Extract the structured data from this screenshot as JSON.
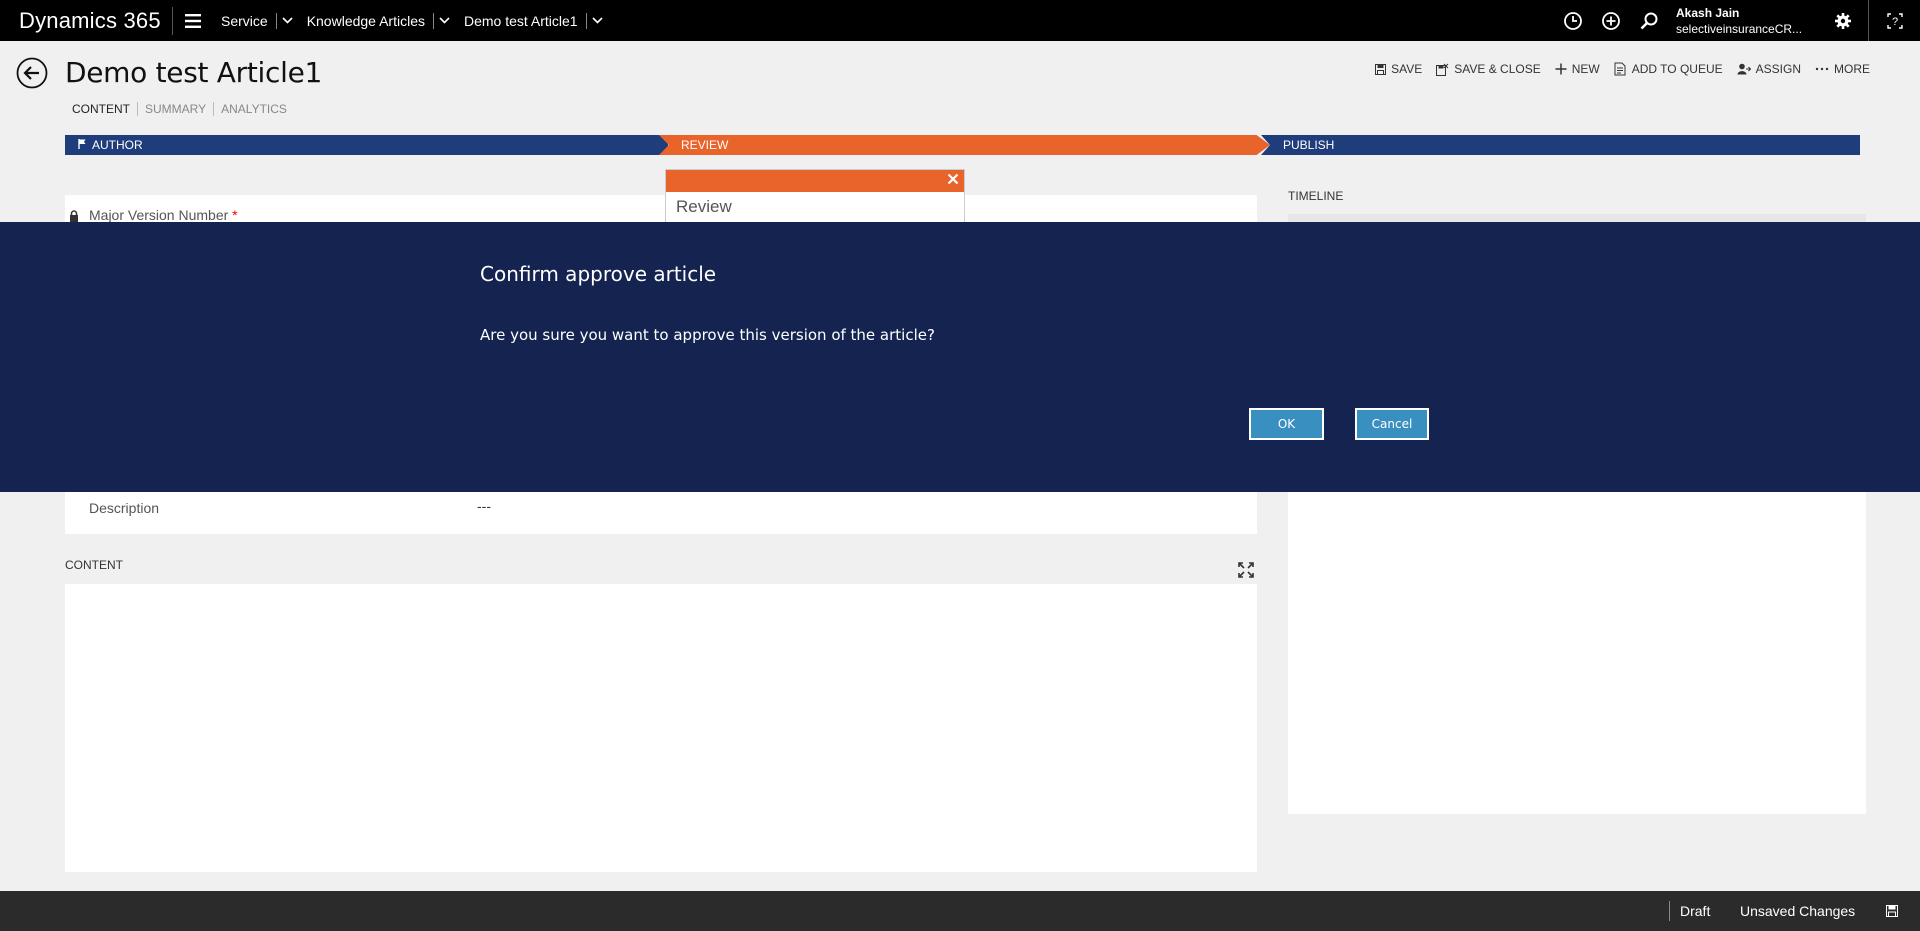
{
  "topnav": {
    "brand": "Dynamics 365",
    "breadcrumbs": [
      "Service",
      "Knowledge Articles",
      "Demo test Article1"
    ],
    "user_name": "Akash Jain",
    "user_org": "selectiveinsuranceCR...",
    "help_label": "?"
  },
  "header": {
    "title": "Demo test Article1",
    "tabs": [
      "CONTENT",
      "SUMMARY",
      "ANALYTICS"
    ],
    "commands": [
      "SAVE",
      "SAVE & CLOSE",
      "NEW",
      "ADD TO QUEUE",
      "ASSIGN",
      "MORE"
    ]
  },
  "process": {
    "stages": [
      "AUTHOR",
      "REVIEW",
      "PUBLISH"
    ],
    "active_stage": "REVIEW",
    "active_color": "#e8642a",
    "inactive_color": "#1f3d7a",
    "flyout_title": "Review"
  },
  "form": {
    "major_version_label": "Major Version Number",
    "required_mark": "*",
    "description_label": "Description",
    "description_value": "---",
    "content_label": "CONTENT",
    "timeline_label": "TIMELINE"
  },
  "modal": {
    "title": "Confirm approve article",
    "message": "Are you sure you want to approve this version of the article?",
    "ok_label": "OK",
    "cancel_label": "Cancel",
    "background": "#152350",
    "button_color": "#3a8fc1"
  },
  "footer": {
    "status": "Draft",
    "unsaved": "Unsaved Changes"
  },
  "icons": [
    "menu-icon",
    "chevron-down-icon",
    "history-icon",
    "add-circle-icon",
    "search-icon",
    "gear-icon",
    "help-icon",
    "back-arrow-icon",
    "save-icon",
    "save-close-icon",
    "plus-icon",
    "add-queue-icon",
    "assign-icon",
    "more-icon",
    "flag-icon",
    "lock-icon",
    "close-icon",
    "expand-icon"
  ]
}
